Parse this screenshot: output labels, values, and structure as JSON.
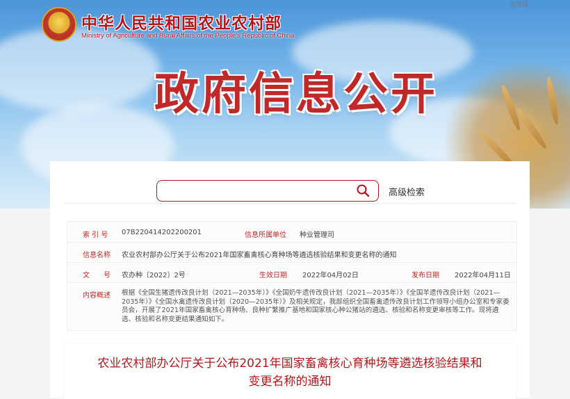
{
  "header": {
    "accessibility": "无障碍",
    "ministry_cn": "中华人民共和国农业农村部",
    "ministry_en": "Ministry of Agriculture and Rural Affairs of the People's Republic of China",
    "banner_title": "政府信息公开"
  },
  "search": {
    "value": "",
    "advanced_label": "高级检索",
    "icon": "search-icon"
  },
  "info": {
    "index_label": "索 引 号",
    "index_value": "07B220414202200201",
    "org_label": "信息所属单位",
    "org_value": "种业管理司",
    "name_label": "信息名称",
    "name_value": "农业农村部办公厅关于公布2021年国家畜禽核心育种场等遴选核验结果和变更名称的通知",
    "docno_label": "文　　号",
    "docno_value": "农办种〔2022〕2号",
    "effective_label": "生效日期",
    "effective_value": "2022年04月02日",
    "publish_label": "发布日期",
    "publish_value": "2022年04月11日",
    "summary_label": "内容概述",
    "summary_value": "根据《全国生猪遗传改良计划（2021—2035年）》《全国奶牛遗传改良计划（2021—2035年）》《全国羊遗传改良计划（2021—2035年）》《全国水禽遗传改良计划（2020—2035年）》及相关规定，我部组织全国畜禽遗传改良计划工作领导小组办公室和专家委员会，开展了2021年国家畜禽核心育种场、良种扩繁推广基地和国家核心种公猪站的遴选、核验和名称变更审核等工作。现将遴选、核验和名称变更结果通知如下。"
  },
  "document": {
    "title": "农业农村部办公厅关于公布2021年国家畜禽核心育种场等遴选核验结果和变更名称的通知"
  },
  "colors": {
    "accent": "#b3161a",
    "label": "#c0282a"
  }
}
